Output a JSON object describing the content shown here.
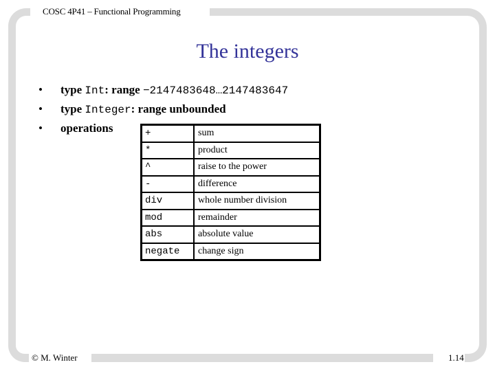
{
  "header": {
    "course": "COSC 4P41 – Functional Programming"
  },
  "slide": {
    "title": "The integers",
    "bullets": [
      {
        "prefix": "type ",
        "code": "Int",
        "suffix": ": range ",
        "code2": "−2147483648…2147483647"
      },
      {
        "prefix": "type ",
        "code": "Integer",
        "suffix": ": range unbounded"
      },
      {
        "text": "operations"
      }
    ],
    "bullet_symbol": "•",
    "operations": [
      {
        "op": "+",
        "desc": "sum"
      },
      {
        "op": "*",
        "desc": "product"
      },
      {
        "op": "^",
        "desc": "raise to the power"
      },
      {
        "op": "-",
        "desc": "difference"
      },
      {
        "op": "div",
        "desc": "whole number division"
      },
      {
        "op": "mod",
        "desc": "remainder"
      },
      {
        "op": "abs",
        "desc": "absolute value"
      },
      {
        "op": "negate",
        "desc": "change sign"
      }
    ]
  },
  "footer": {
    "author": "© M. Winter",
    "page": "1.14"
  },
  "colors": {
    "title": "#333399",
    "frame": "#dcdcdc"
  }
}
